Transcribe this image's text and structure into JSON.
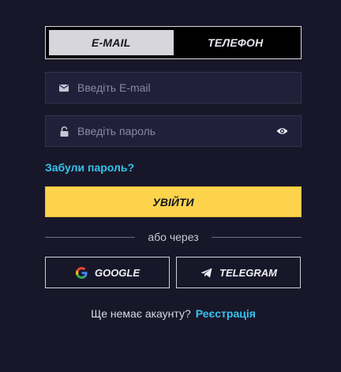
{
  "tabs": [
    {
      "label": "E-MAIL",
      "active": true
    },
    {
      "label": "ТЕЛЕФОН",
      "active": false
    }
  ],
  "email": {
    "placeholder": "Введіть E-mail",
    "value": "",
    "icon": "mail-icon"
  },
  "password": {
    "placeholder": "Введіть пароль",
    "value": "",
    "icon": "lock-icon",
    "toggle_icon": "eye-icon"
  },
  "forgot_password": "Забули пароль?",
  "login_button": "УВІЙТИ",
  "divider_text": "або через",
  "social": {
    "google": {
      "label": "GOOGLE",
      "icon": "google-icon"
    },
    "telegram": {
      "label": "TELEGRAM",
      "icon": "telegram-icon"
    }
  },
  "signup": {
    "question": "Ще немає акаунту?",
    "link": "Реєстрація"
  },
  "colors": {
    "background": "#181729",
    "field_bg": "#211f3a",
    "accent_yellow": "#fcd34b",
    "link_cyan": "#35c3ec"
  }
}
